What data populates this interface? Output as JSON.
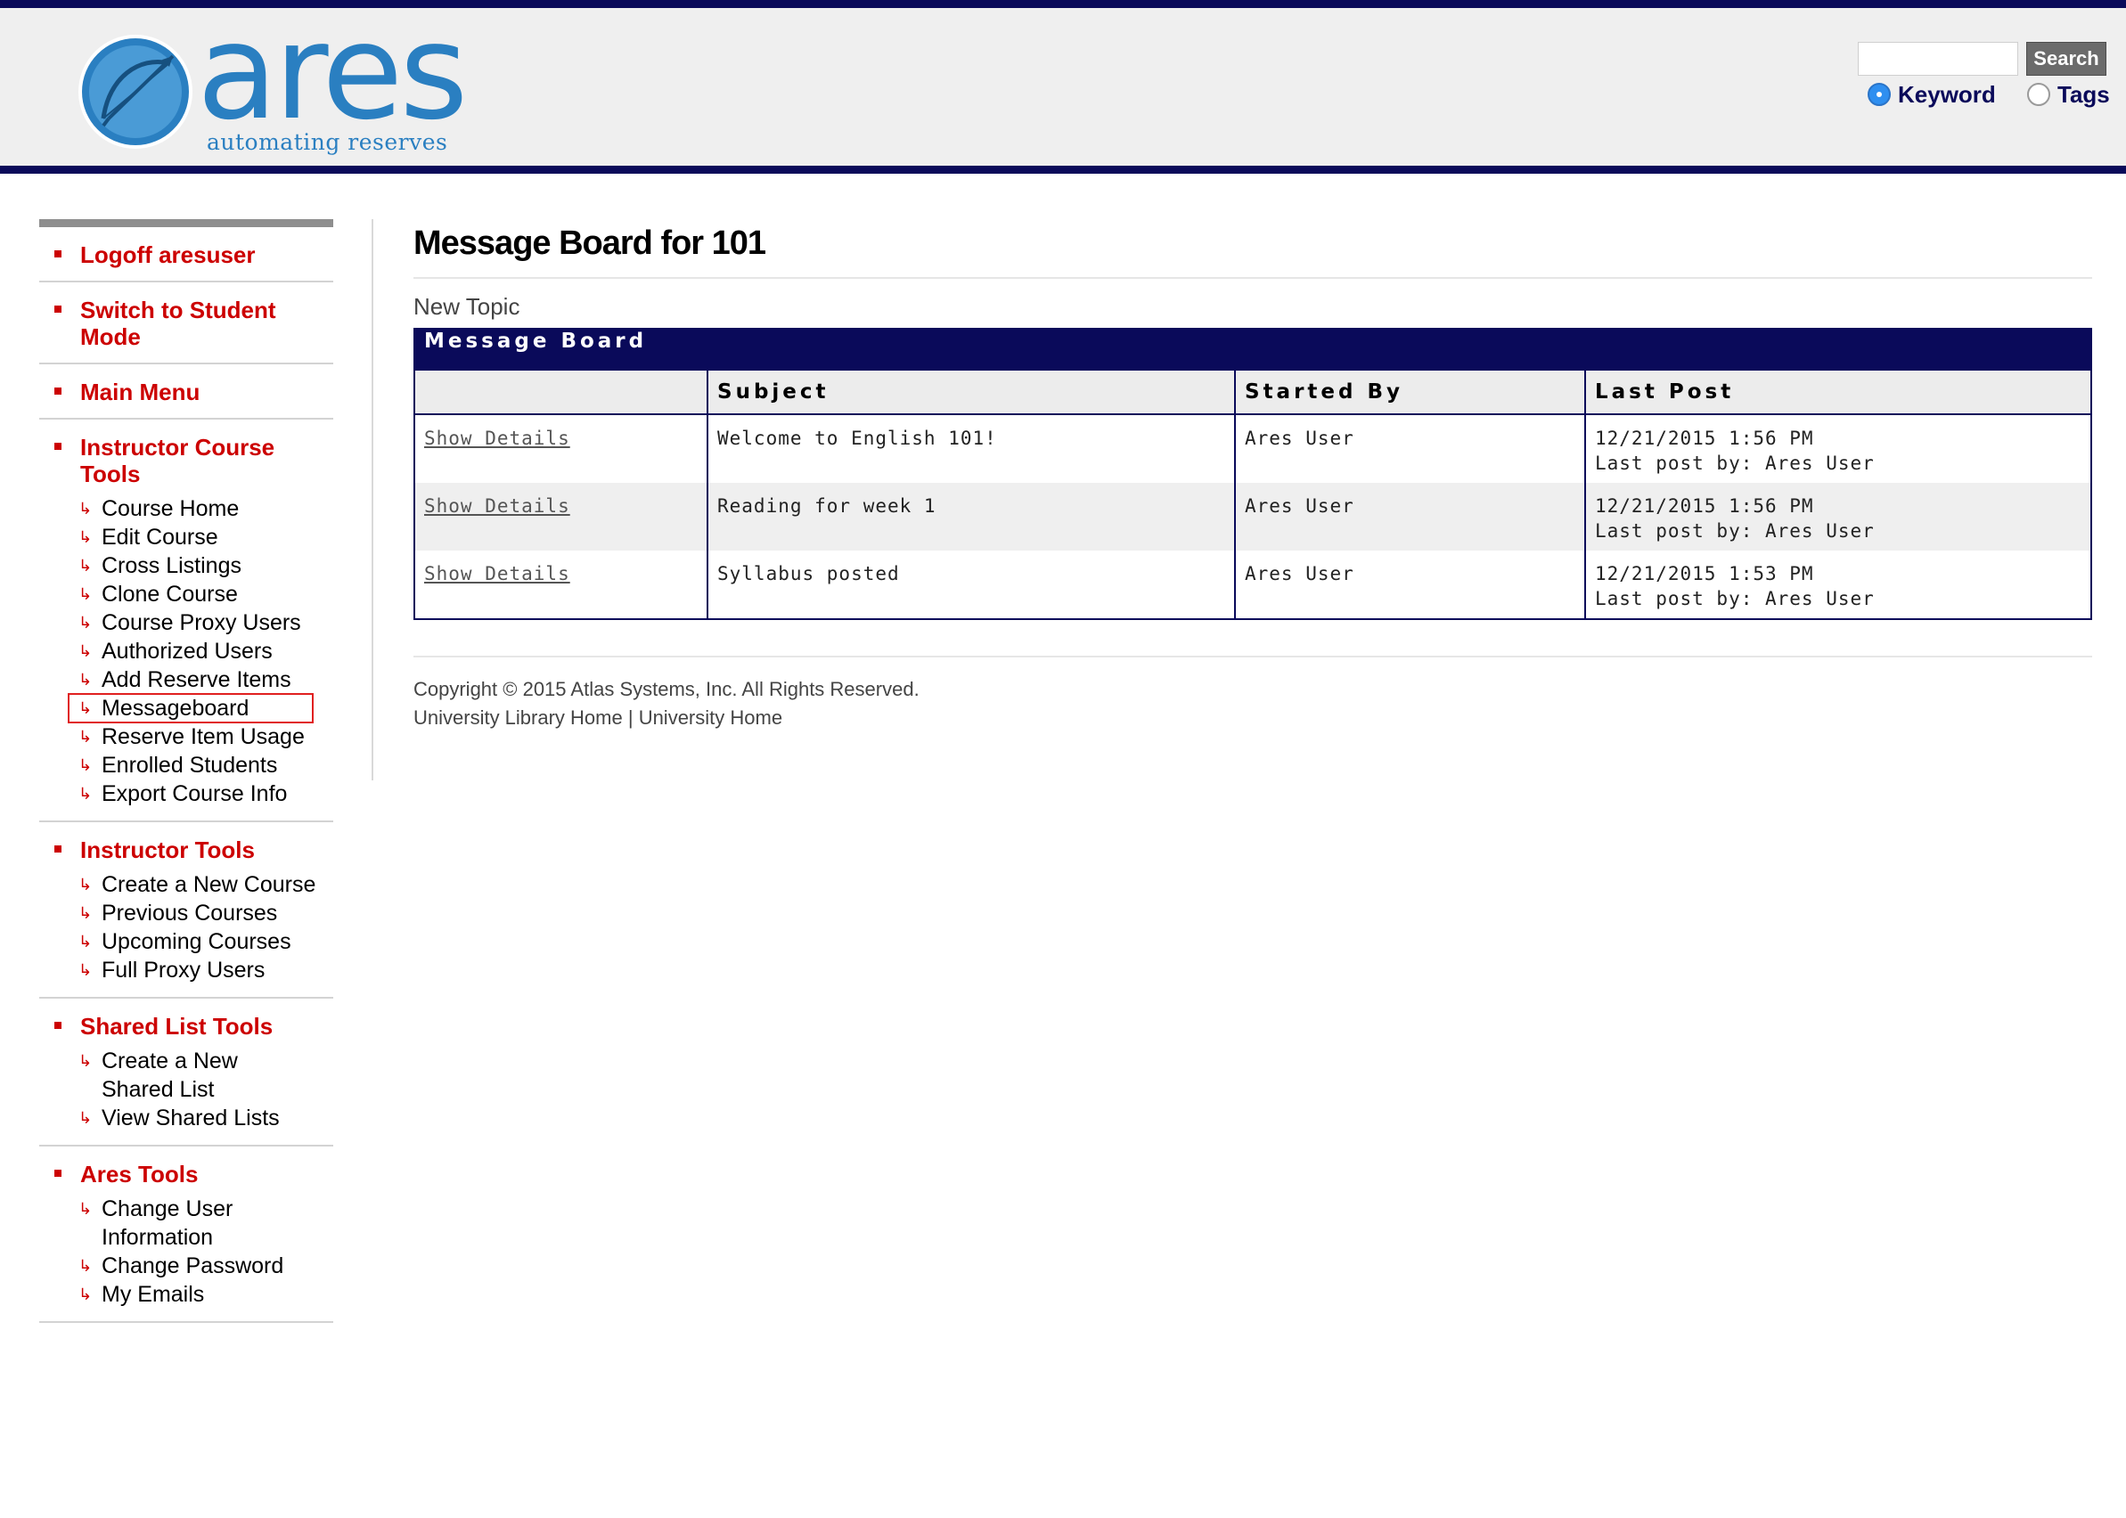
{
  "header": {
    "logo_word": "ares",
    "logo_tagline": "automating reserves",
    "search": {
      "placeholder": "",
      "button_label": "Search"
    },
    "search_options": [
      {
        "label": "Keyword",
        "selected": true
      },
      {
        "label": "Tags",
        "selected": false
      }
    ],
    "brand_color": "#0a0a5a",
    "logo_color": "#2a7fc1"
  },
  "sidebar": {
    "sections": [
      {
        "title": "Logoff aresuser",
        "items": []
      },
      {
        "title": "Switch to Student Mode",
        "items": []
      },
      {
        "title": "Main Menu",
        "items": []
      },
      {
        "title": "Instructor Course Tools",
        "items": [
          "Course Home",
          "Edit Course",
          "Cross Listings",
          "Clone Course",
          "Course Proxy Users",
          "Authorized Users",
          "Add Reserve Items",
          "Messageboard",
          "Reserve Item Usage",
          "Enrolled Students",
          "Export Course Info"
        ]
      },
      {
        "title": "Instructor Tools",
        "items": [
          "Create a New Course",
          "Previous Courses",
          "Upcoming Courses",
          "Full Proxy Users"
        ]
      },
      {
        "title": "Shared List Tools",
        "items": [
          "Create a New Shared List",
          "View Shared Lists"
        ]
      },
      {
        "title": "Ares Tools",
        "items": [
          "Change User Information",
          "Change Password",
          "My Emails"
        ]
      }
    ],
    "selected_item": "Messageboard",
    "accent_color": "#cc0000"
  },
  "main": {
    "title": "Message Board for 101",
    "new_topic": "New Topic",
    "board": {
      "heading": "Message Board",
      "columns": [
        "",
        "Subject",
        "Started By",
        "Last Post"
      ],
      "rows": [
        {
          "link": "Show Details",
          "subject": "Welcome to English 101!",
          "started_by": "Ares User",
          "last_post_time": "12/21/2015 1:56 PM",
          "last_post_by": "Last post by: Ares User"
        },
        {
          "link": "Show Details",
          "subject": "Reading for week 1",
          "started_by": "Ares User",
          "last_post_time": "12/21/2015 1:56 PM",
          "last_post_by": "Last post by: Ares User"
        },
        {
          "link": "Show Details",
          "subject": "Syllabus posted",
          "started_by": "Ares User",
          "last_post_time": "12/21/2015 1:53 PM",
          "last_post_by": "Last post by: Ares User"
        }
      ]
    },
    "footer": {
      "copyright": "Copyright © 2015 Atlas Systems, Inc. All Rights Reserved.",
      "links": [
        "University Library Home",
        "University Home"
      ],
      "separator": " | "
    }
  }
}
